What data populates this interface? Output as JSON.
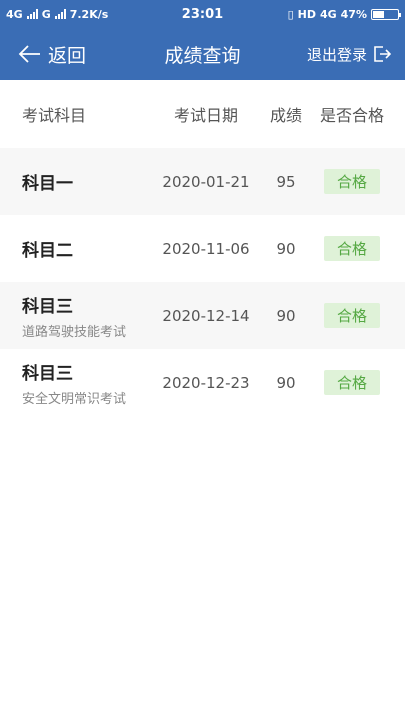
{
  "status_bar": {
    "left_network_1": "4G",
    "left_network_2": "G",
    "speed": "7.2K/s",
    "time": "23:01",
    "right_hd": "HD",
    "right_network": "4G",
    "battery": "47%",
    "battery_level": 0.47
  },
  "header": {
    "back_label": "返回",
    "title": "成绩查询",
    "logout_label": "退出登录"
  },
  "table": {
    "columns": [
      "考试科目",
      "考试日期",
      "成绩",
      "是否合格"
    ],
    "rows": [
      {
        "subject": "科目一",
        "sub": "",
        "date": "2020-01-21",
        "score": "95",
        "result": "合格"
      },
      {
        "subject": "科目二",
        "sub": "",
        "date": "2020-11-06",
        "score": "90",
        "result": "合格"
      },
      {
        "subject": "科目三",
        "sub": "道路驾驶技能考试",
        "date": "2020-12-14",
        "score": "90",
        "result": "合格"
      },
      {
        "subject": "科目三",
        "sub": "安全文明常识考试",
        "date": "2020-12-23",
        "score": "90",
        "result": "合格"
      }
    ]
  },
  "colors": {
    "header_bg": "#3a6db5",
    "pass_bg": "#dff2d8",
    "pass_text": "#55a843"
  }
}
